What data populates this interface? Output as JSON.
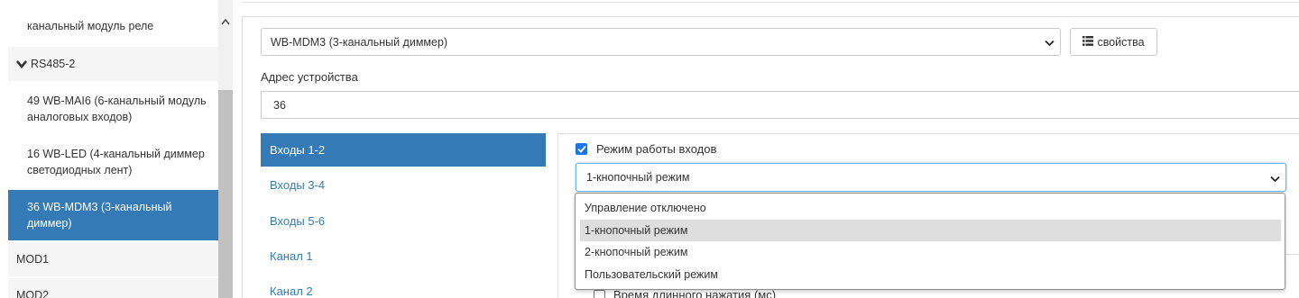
{
  "sidebar": {
    "items": [
      {
        "label": "канальный модуль реле",
        "kind": "sub"
      },
      {
        "label": "RS485-2",
        "kind": "group",
        "icon": "chevron-down-icon"
      },
      {
        "label": "49 WB-MAI6 (6-канальный модуль аналоговых входов)",
        "kind": "sub"
      },
      {
        "label": "16 WB-LED (4-канальный диммер светодиодных лент)",
        "kind": "sub"
      },
      {
        "label": "36 WB-MDM3 (3-канальный диммер)",
        "kind": "sub",
        "active": true
      },
      {
        "label": "MOD1",
        "kind": "group"
      },
      {
        "label": "MOD2",
        "kind": "group"
      }
    ],
    "scroll_up_icon": "triangle-up-icon"
  },
  "device": {
    "selected": "WB-MDM3 (3-канальный диммер)",
    "properties_label": "свойства",
    "properties_icon": "list-icon"
  },
  "address": {
    "label": "Адрес устройства",
    "value": "36"
  },
  "tabs": [
    {
      "label": "Входы 1-2",
      "active": true
    },
    {
      "label": "Входы 3-4"
    },
    {
      "label": "Входы 5-6"
    },
    {
      "label": "Канал 1"
    },
    {
      "label": "Канал 2"
    }
  ],
  "input_mode": {
    "checkbox_label": "Режим работы входов",
    "checked": true,
    "selected": "1-кнопочный режим",
    "options": [
      "Управление отключено",
      "1-кнопочный режим",
      "2-кнопочный режим",
      "Пользовательский режим"
    ],
    "highlighted_index": 1
  },
  "long_press": {
    "label": "Время длинного нажатия (мс)"
  },
  "colors": {
    "accent": "#337ab7",
    "checkbox": "#1a73e8",
    "focus_border": "#66afe9"
  }
}
